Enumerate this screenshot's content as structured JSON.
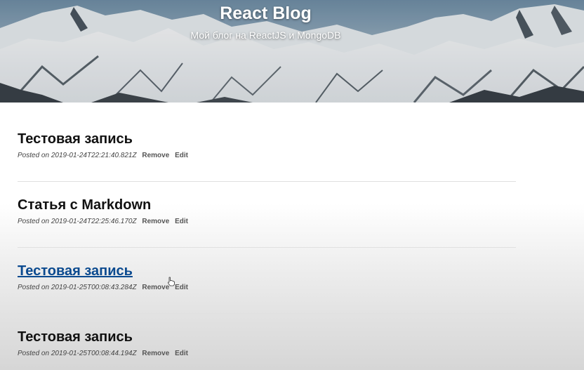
{
  "header": {
    "title": "React Blog",
    "subtitle": "Мой блог на ReactJS и MongoDB"
  },
  "posts": [
    {
      "title": "Тестовая запись",
      "posted_prefix": "Posted on",
      "date": "2019-01-24T22:21:40.821Z",
      "remove_label": "Remove",
      "edit_label": "Edit",
      "hovered": false
    },
    {
      "title": "Статья с Markdown",
      "posted_prefix": "Posted on",
      "date": "2019-01-24T22:25:46.170Z",
      "remove_label": "Remove",
      "edit_label": "Edit",
      "hovered": false
    },
    {
      "title": "Тестовая запись",
      "posted_prefix": "Posted on",
      "date": "2019-01-25T00:08:43.284Z",
      "remove_label": "Remove",
      "edit_label": "Edit",
      "hovered": true
    },
    {
      "title": "Тестовая запись",
      "posted_prefix": "Posted on",
      "date": "2019-01-25T00:08:44.194Z",
      "remove_label": "Remove",
      "edit_label": "Edit",
      "hovered": false
    }
  ],
  "colors": {
    "link_hover": "#0b4a8f",
    "title": "#111111",
    "meta": "#444444"
  },
  "icons": {
    "cursor": "hand-pointer-icon",
    "header_background": "snowy-mountains-image"
  }
}
